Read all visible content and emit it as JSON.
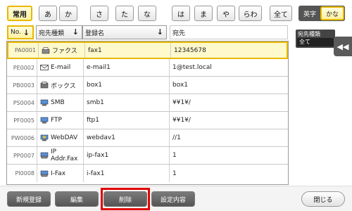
{
  "tabs": {
    "favorites": "常用",
    "kana": [
      "あ",
      "か",
      "さ",
      "た",
      "な",
      "は",
      "ま",
      "や",
      "らわ"
    ],
    "all": "全て"
  },
  "script_toggle": {
    "alpha": "英字",
    "kana": "かな"
  },
  "headers": {
    "no": "No.",
    "type": "宛先種類",
    "name": "登録名",
    "address": "宛先"
  },
  "rows": [
    {
      "no": "PA0001",
      "type": "ファクス",
      "icon": "fax-icon",
      "name": "fax1",
      "address": "12345678"
    },
    {
      "no": "PE0002",
      "type": "E-mail",
      "icon": "email-icon",
      "name": "e-mail1",
      "address": "1@test.local"
    },
    {
      "no": "PB0003",
      "type": "ボックス",
      "icon": "box-icon",
      "name": "box1",
      "address": "box1"
    },
    {
      "no": "PS0004",
      "type": "SMB",
      "icon": "smb-icon",
      "name": "smb1",
      "address": "¥¥1¥/"
    },
    {
      "no": "PF0005",
      "type": "FTP",
      "icon": "ftp-icon",
      "name": "ftp1",
      "address": "¥¥1¥/"
    },
    {
      "no": "PW0006",
      "type": "WebDAV",
      "icon": "webdav-icon",
      "name": "webdav1",
      "address": "//1"
    },
    {
      "no": "PP0007",
      "type": "IP Addr.Fax",
      "icon": "ipfax-icon",
      "name": "ip-fax1",
      "address": "1"
    },
    {
      "no": "PI0008",
      "type": "I-Fax",
      "icon": "ifax-icon",
      "name": "i-fax1",
      "address": "1"
    }
  ],
  "filter": {
    "label": "宛先種類",
    "value": "全て"
  },
  "side_tab_icon": "double-chevron-left-icon",
  "buttons": {
    "register": "新規登録",
    "edit": "編集",
    "delete": "削除",
    "settings": "設定内容",
    "close": "閉じる"
  },
  "colors": {
    "accent_yellow": "#e8b800",
    "highlight_red": "#e00000"
  }
}
